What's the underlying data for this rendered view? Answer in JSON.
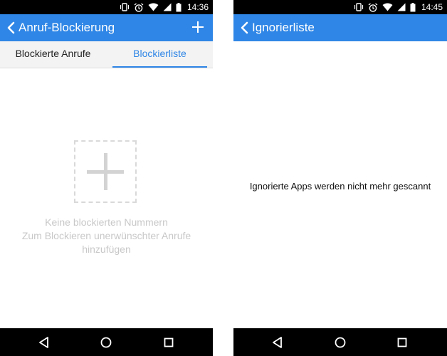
{
  "left": {
    "status": {
      "time": "14:36",
      "icons": [
        "vibrate-icon",
        "alarm-icon",
        "wifi-icon",
        "cell-signal-icon",
        "battery-icon"
      ]
    },
    "appbar": {
      "title": "Anruf-Blockierung",
      "back_icon": "chevron-left-icon",
      "action_icon": "plus-icon"
    },
    "tabs": [
      {
        "label": "Blockierte Anrufe",
        "selected": false
      },
      {
        "label": "Blockierliste",
        "selected": true
      }
    ],
    "empty_state": {
      "icon": "plus-icon",
      "line1": "Keine blockierten Nummern",
      "line2": "Zum Blockieren unerwünschter Anrufe",
      "line3": "hinzufügen"
    }
  },
  "right": {
    "status": {
      "time": "14:45",
      "icons": [
        "vibrate-icon",
        "alarm-icon",
        "wifi-icon",
        "cell-signal-icon",
        "battery-icon"
      ]
    },
    "appbar": {
      "title": "Ignorierliste",
      "back_icon": "chevron-left-icon"
    },
    "message": "Ignorierte Apps werden nicht mehr gescannt"
  },
  "navbar": {
    "icons": [
      "back-triangle-icon",
      "home-circle-icon",
      "recents-square-icon"
    ]
  },
  "colors": {
    "accent": "#2f86e6",
    "tabs_bg": "#f3f3f3",
    "empty_text": "#c8c8c8"
  }
}
